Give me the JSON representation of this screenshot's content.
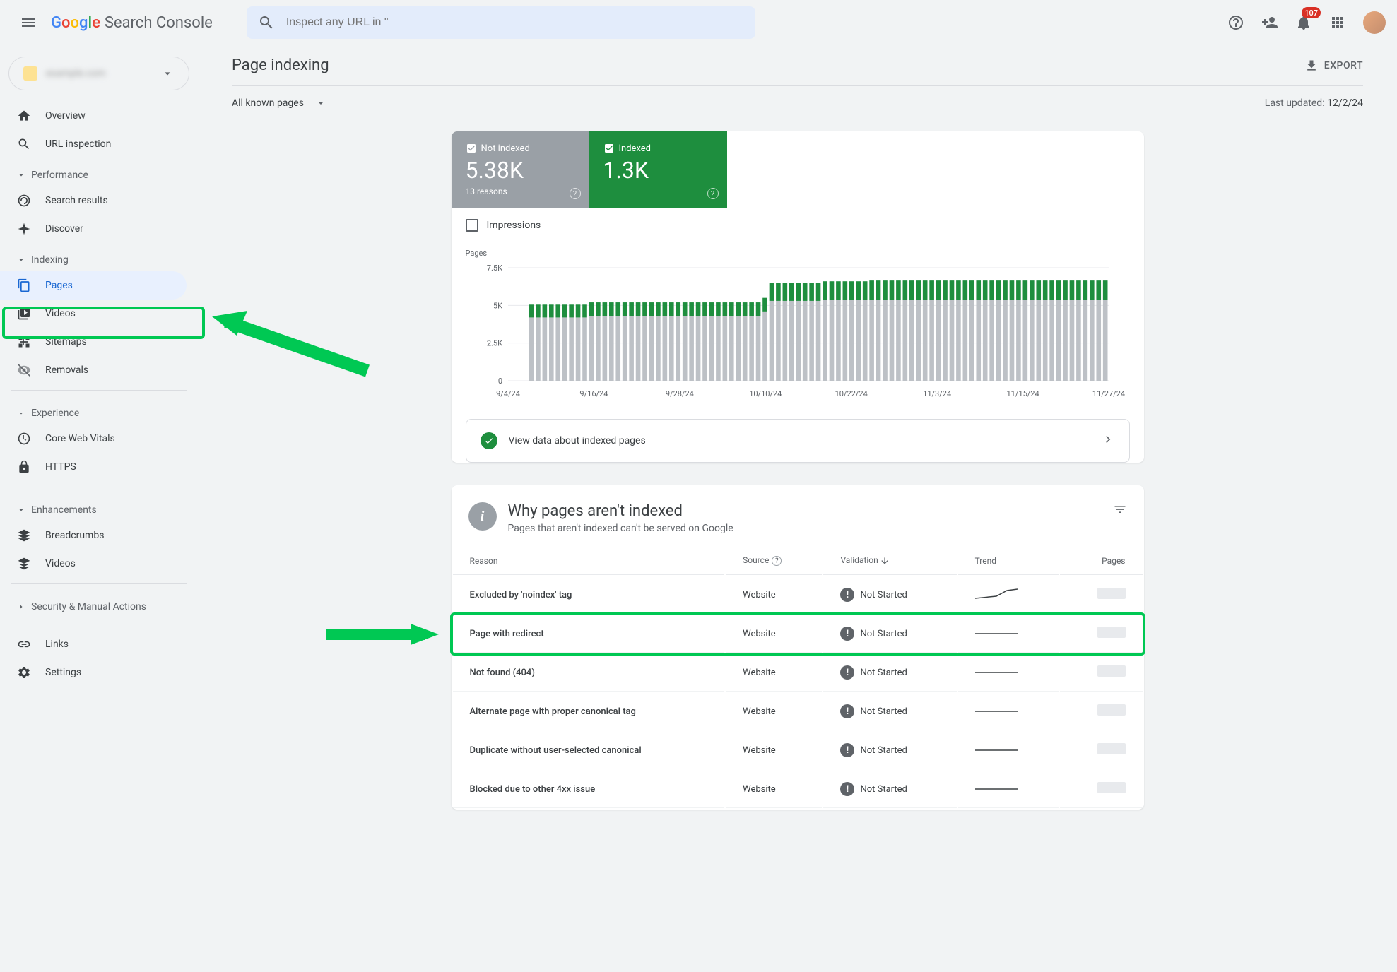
{
  "header": {
    "product": "Search Console",
    "search_placeholder": "Inspect any URL in \"",
    "notification_count": "107"
  },
  "sidebar": {
    "property_domain": "example.com",
    "overview": "Overview",
    "url_inspection": "URL inspection",
    "section_performance": "Performance",
    "search_results": "Search results",
    "discover": "Discover",
    "section_indexing": "Indexing",
    "pages": "Pages",
    "videos": "Videos",
    "sitemaps": "Sitemaps",
    "removals": "Removals",
    "section_experience": "Experience",
    "core_web_vitals": "Core Web Vitals",
    "https": "HTTPS",
    "section_enhancements": "Enhancements",
    "breadcrumbs": "Breadcrumbs",
    "videos2": "Videos",
    "security": "Security & Manual Actions",
    "links": "Links",
    "settings": "Settings"
  },
  "page": {
    "title": "Page indexing",
    "export": "EXPORT",
    "filter": "All known pages",
    "last_updated_label": "Last updated:",
    "last_updated_date": "12/2/24"
  },
  "metrics": {
    "not_indexed_label": "Not indexed",
    "not_indexed_value": "5.38K",
    "not_indexed_sub": "13 reasons",
    "indexed_label": "Indexed",
    "indexed_value": "1.3K",
    "impressions_label": "Impressions"
  },
  "chart_data": {
    "type": "bar",
    "title": "Pages",
    "ylabel": "Pages",
    "ylim": [
      0,
      7500
    ],
    "yticks": [
      "0",
      "2.5K",
      "5K",
      "7.5K"
    ],
    "xticks": [
      "9/4/24",
      "9/16/24",
      "9/28/24",
      "10/10/24",
      "10/22/24",
      "11/3/24",
      "11/15/24",
      "11/27/24"
    ],
    "series": [
      {
        "name": "Not indexed",
        "color": "#bdc1c6",
        "values": [
          0,
          0,
          0,
          4200,
          4200,
          4200,
          4200,
          4200,
          4200,
          4200,
          4200,
          4200,
          4300,
          4300,
          4300,
          4300,
          4300,
          4300,
          4300,
          4300,
          4300,
          4300,
          4300,
          4300,
          4300,
          4300,
          4300,
          4300,
          4300,
          4300,
          4300,
          4300,
          4300,
          4300,
          4300,
          4300,
          4300,
          4300,
          4600,
          5300,
          5300,
          5300,
          5300,
          5300,
          5300,
          5300,
          5300,
          5350,
          5350,
          5350,
          5350,
          5350,
          5350,
          5350,
          5350,
          5350,
          5350,
          5350,
          5350,
          5350,
          5350,
          5350,
          5350,
          5350,
          5350,
          5350,
          5350,
          5350,
          5350,
          5350,
          5350,
          5350,
          5350,
          5350,
          5350,
          5350,
          5350,
          5350,
          5350,
          5350,
          5350,
          5350,
          5350,
          5350,
          5350,
          5350,
          5350,
          5350,
          5350,
          5350
        ]
      },
      {
        "name": "Indexed",
        "color": "#1e8e3e",
        "values": [
          0,
          0,
          0,
          850,
          850,
          850,
          850,
          850,
          850,
          850,
          850,
          850,
          900,
          900,
          900,
          900,
          900,
          900,
          900,
          900,
          900,
          900,
          900,
          900,
          900,
          900,
          900,
          900,
          900,
          900,
          900,
          900,
          900,
          900,
          900,
          900,
          900,
          900,
          900,
          1200,
          1200,
          1200,
          1200,
          1200,
          1200,
          1200,
          1200,
          1250,
          1250,
          1250,
          1250,
          1250,
          1250,
          1250,
          1300,
          1300,
          1300,
          1300,
          1300,
          1300,
          1300,
          1300,
          1300,
          1300,
          1300,
          1300,
          1300,
          1300,
          1300,
          1300,
          1300,
          1300,
          1300,
          1300,
          1300,
          1300,
          1300,
          1300,
          1300,
          1300,
          1300,
          1300,
          1300,
          1300,
          1300,
          1300,
          1300,
          1300,
          1300,
          1300
        ]
      }
    ]
  },
  "view_indexed": "View data about indexed pages",
  "why": {
    "title": "Why pages aren't indexed",
    "sub": "Pages that aren't indexed can't be served on Google",
    "col_reason": "Reason",
    "col_source": "Source",
    "col_validation": "Validation",
    "col_trend": "Trend",
    "col_pages": "Pages",
    "rows": [
      {
        "reason": "Excluded by 'noindex' tag",
        "source": "Website",
        "validation": "Not Started",
        "trend": "up"
      },
      {
        "reason": "Page with redirect",
        "source": "Website",
        "validation": "Not Started",
        "trend": "flat"
      },
      {
        "reason": "Not found (404)",
        "source": "Website",
        "validation": "Not Started",
        "trend": "flat"
      },
      {
        "reason": "Alternate page with proper canonical tag",
        "source": "Website",
        "validation": "Not Started",
        "trend": "flat"
      },
      {
        "reason": "Duplicate without user-selected canonical",
        "source": "Website",
        "validation": "Not Started",
        "trend": "flat"
      },
      {
        "reason": "Blocked due to other 4xx issue",
        "source": "Website",
        "validation": "Not Started",
        "trend": "flat"
      }
    ]
  }
}
